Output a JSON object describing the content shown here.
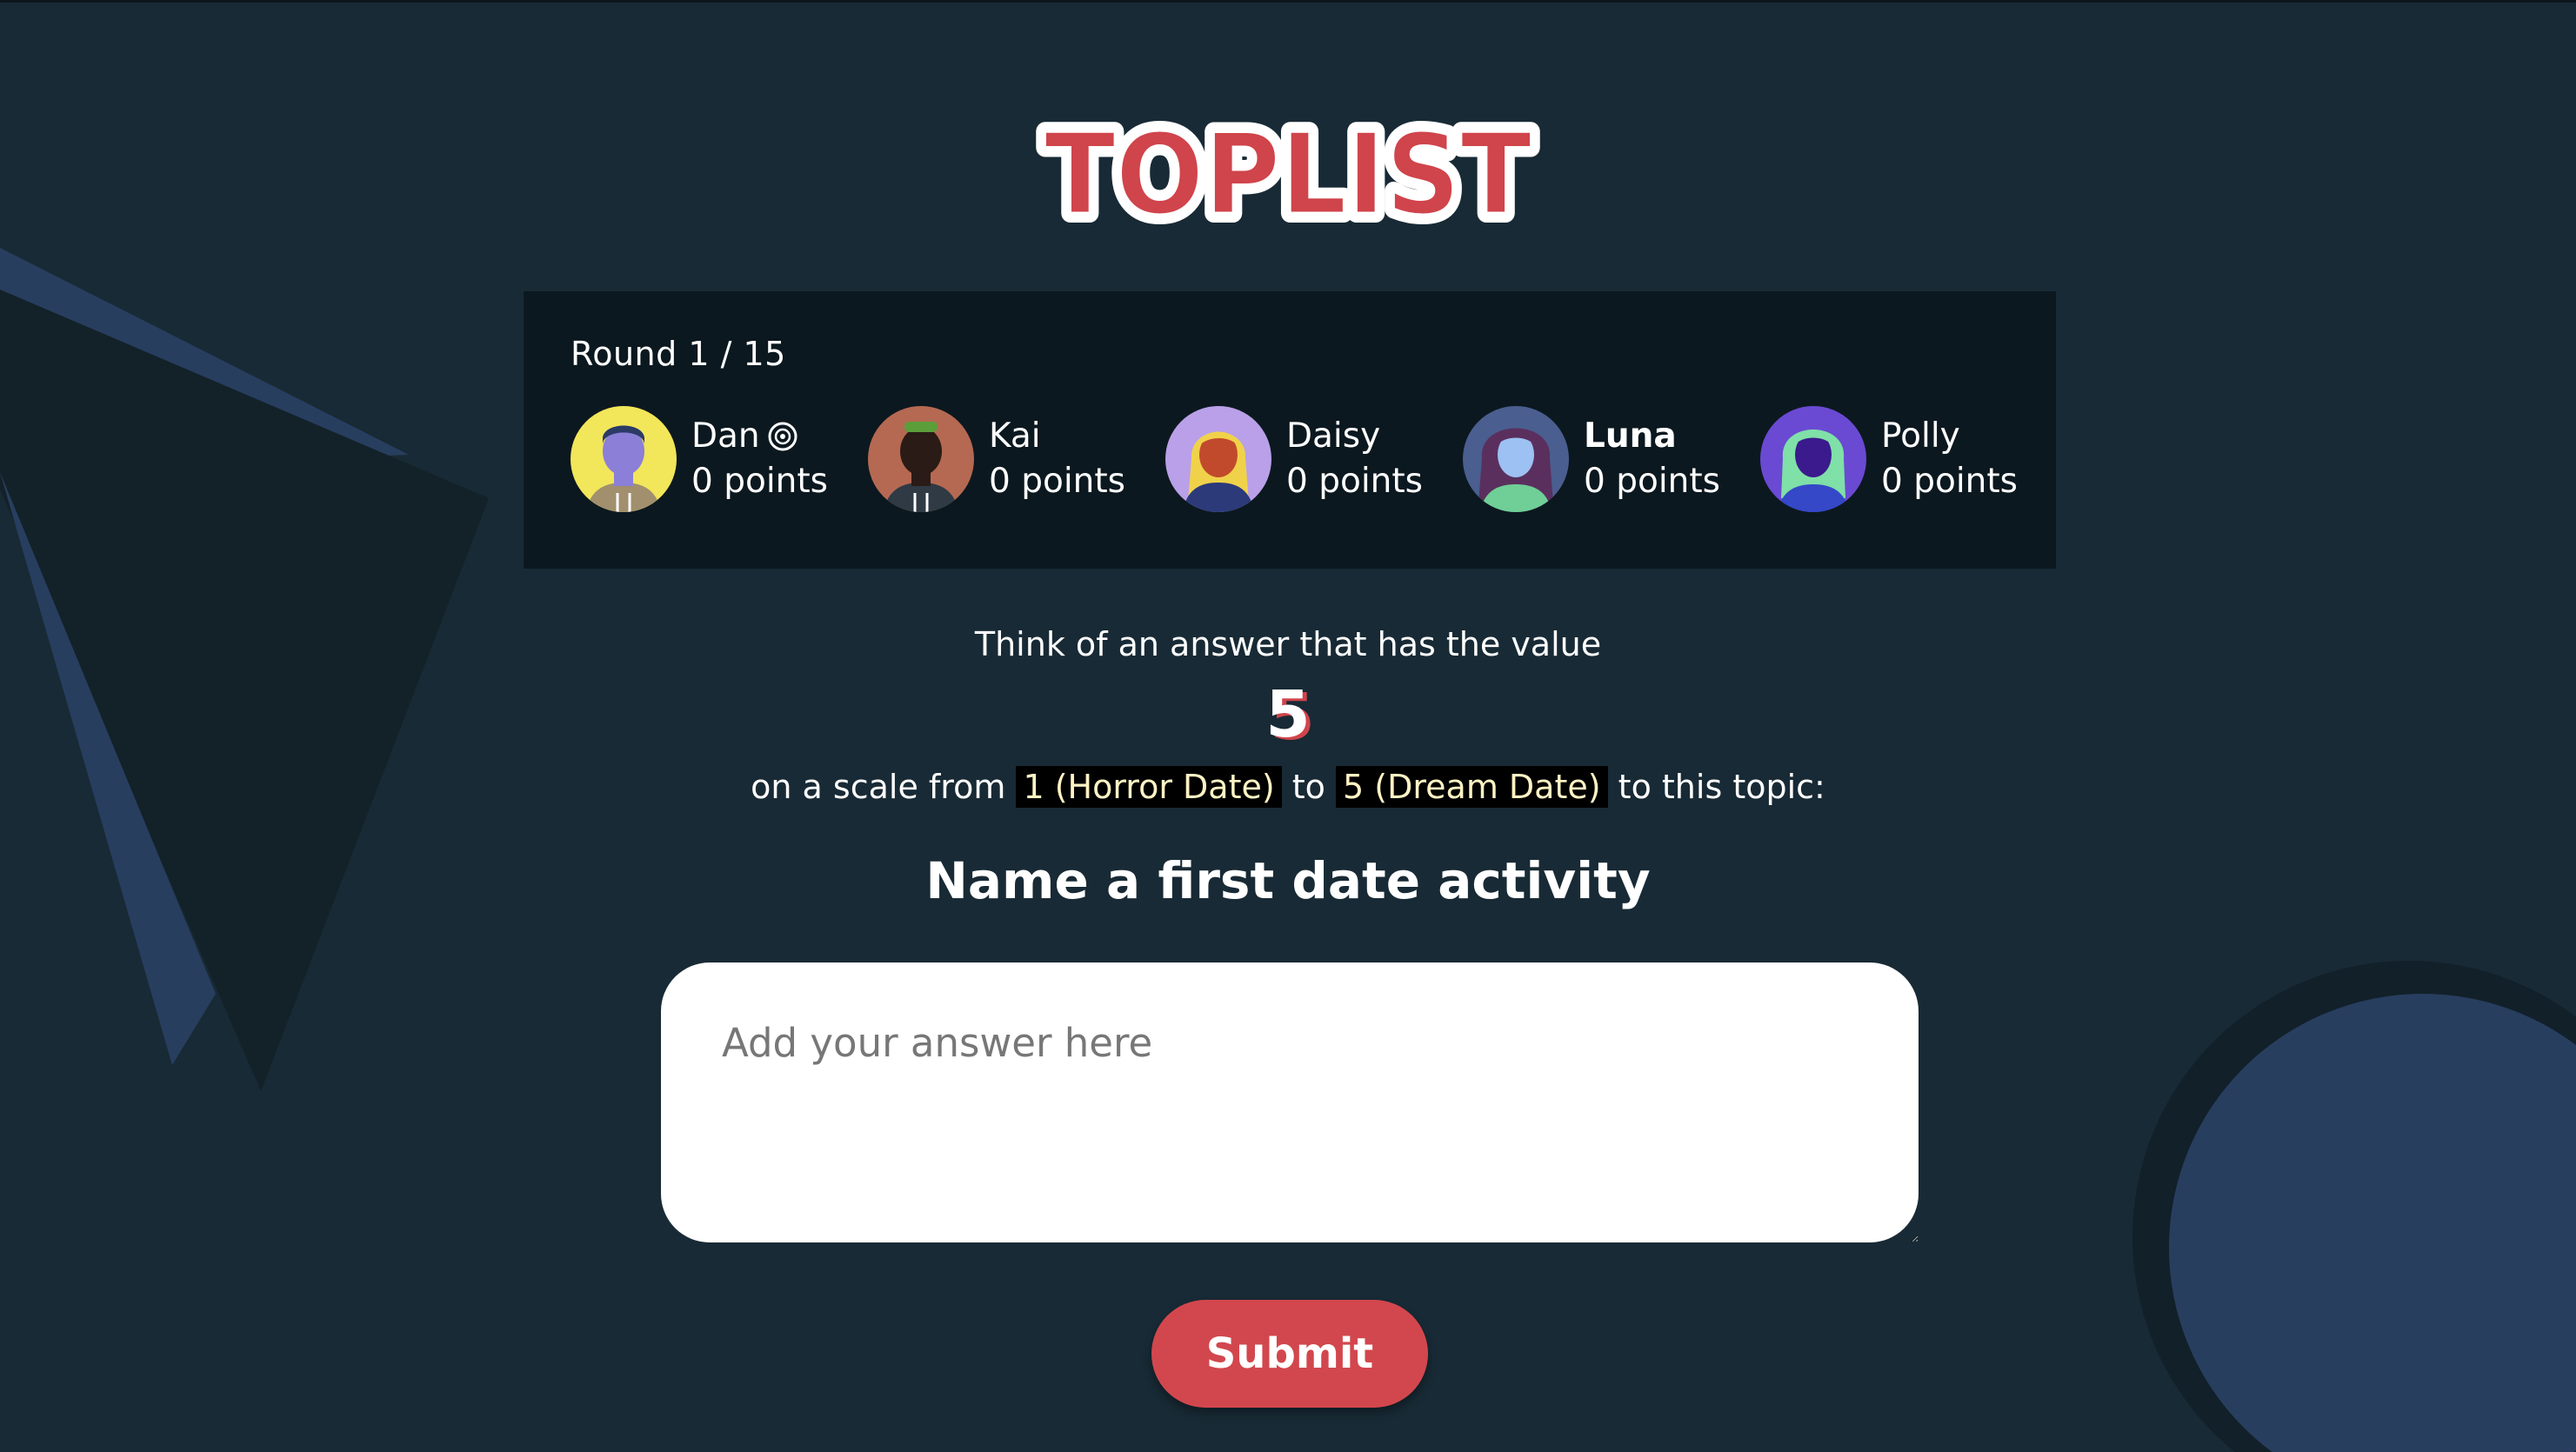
{
  "app": {
    "logo_text": "TOPLIST"
  },
  "colors": {
    "background": "#182a35",
    "scoreboard_bg": "#0c181f",
    "accent_red": "#d2474d",
    "highlight_text": "#fff3c4"
  },
  "scoreboard": {
    "round_label": "Round 1 / 15",
    "players": [
      {
        "name": "Dan",
        "points": "0 points",
        "host_icon": "host-badge-icon"
      },
      {
        "name": "Kai",
        "points": "0 points"
      },
      {
        "name": "Daisy",
        "points": "0 points"
      },
      {
        "name": "Luna",
        "points": "0 points",
        "is_current_user": true
      },
      {
        "name": "Polly",
        "points": "0 points"
      }
    ]
  },
  "prompt": {
    "intro": "Think of an answer that has the value",
    "value": "5",
    "scale_prefix": "on a scale from",
    "scale_min": "1 (Horror Date)",
    "scale_to": "to",
    "scale_max": "5 (Dream Date)",
    "scale_suffix": "to this topic:",
    "topic": "Name a first date activity"
  },
  "answer": {
    "placeholder": "Add your answer here",
    "value": ""
  },
  "actions": {
    "submit_label": "Submit"
  }
}
